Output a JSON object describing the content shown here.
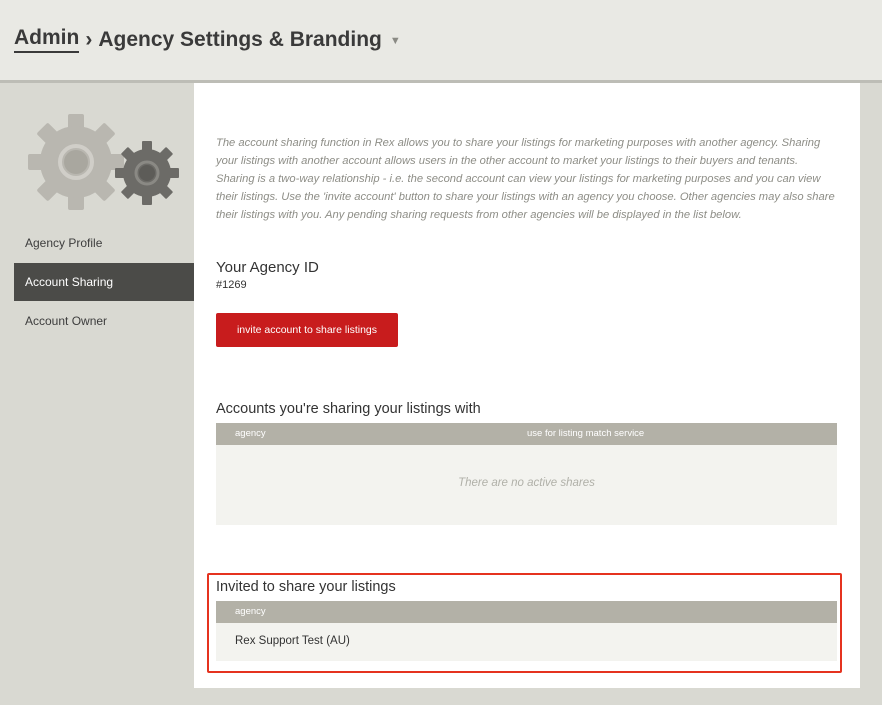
{
  "header": {
    "breadcrumb_root": "Admin",
    "separator": "›",
    "page_title": "Agency Settings & Branding",
    "dropdown_caret": "▼"
  },
  "sidebar": {
    "icon": "gears-icon",
    "items": [
      {
        "label": "Agency Profile",
        "active": false
      },
      {
        "label": "Account Sharing",
        "active": true
      },
      {
        "label": "Account Owner",
        "active": false
      }
    ]
  },
  "main": {
    "intro": "The account sharing function in Rex allows you to share your listings for marketing purposes with another agency. Sharing your listings with another account allows users in the other account to market your listings to their buyers and tenants. Sharing is a two-way relationship - i.e. the second account can view your listings for marketing purposes and you can view their listings. Use the 'invite account' button to share your listings with an agency you choose. Other agencies may also share their listings with you. Any pending sharing requests from other agencies will be displayed in the list below.",
    "agency_id_heading": "Your Agency ID",
    "agency_id": "#1269",
    "invite_button": "invite account to share listings",
    "sharing": {
      "heading": "Accounts you're sharing your listings with",
      "columns": [
        "agency",
        "use for listing match service"
      ],
      "empty_message": "There are no active shares"
    },
    "invited": {
      "heading": "Invited to share your listings",
      "columns": [
        "agency"
      ],
      "rows": [
        {
          "agency": "Rex Support Test (AU)"
        }
      ]
    }
  },
  "colors": {
    "accent_red": "#c81c1d",
    "highlight_border": "#e5331f",
    "sidebar_active_bg": "#4b4b48",
    "table_header_bg": "#b3b1a7"
  }
}
